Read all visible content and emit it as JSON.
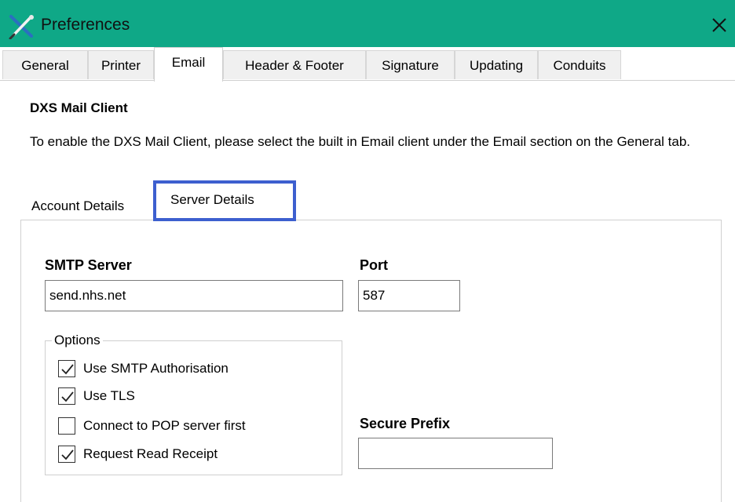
{
  "window": {
    "title": "Preferences"
  },
  "tabs": [
    {
      "label": "General",
      "active": false
    },
    {
      "label": "Printer",
      "active": false
    },
    {
      "label": "Email",
      "active": true
    },
    {
      "label": "Header & Footer",
      "active": false
    },
    {
      "label": "Signature",
      "active": false
    },
    {
      "label": "Updating",
      "active": false
    },
    {
      "label": "Conduits",
      "active": false
    }
  ],
  "email": {
    "section_title": "DXS Mail Client",
    "description": "To enable the DXS Mail Client, please select the built in Email client under the Email section on the General tab."
  },
  "subtabs": [
    {
      "label": "Account Details",
      "active": false
    },
    {
      "label": "Server Details",
      "active": true
    }
  ],
  "server": {
    "smtp_label": "SMTP Server",
    "smtp_value": "send.nhs.net",
    "port_label": "Port",
    "port_value": "587",
    "secure_prefix_label": "Secure Prefix",
    "secure_prefix_value": ""
  },
  "options": {
    "title": "Options",
    "items": [
      {
        "label": "Use SMTP Authorisation",
        "checked": true
      },
      {
        "label": "Use TLS",
        "checked": true
      },
      {
        "label": "Connect to POP server first",
        "checked": false
      },
      {
        "label": "Request Read Receipt",
        "checked": true
      }
    ]
  },
  "colors": {
    "titlebar": "#0fa887",
    "highlight": "#3d5fcf"
  },
  "icons": {
    "app": "tools-icon",
    "close": "close-icon",
    "check": "checkmark-icon"
  }
}
